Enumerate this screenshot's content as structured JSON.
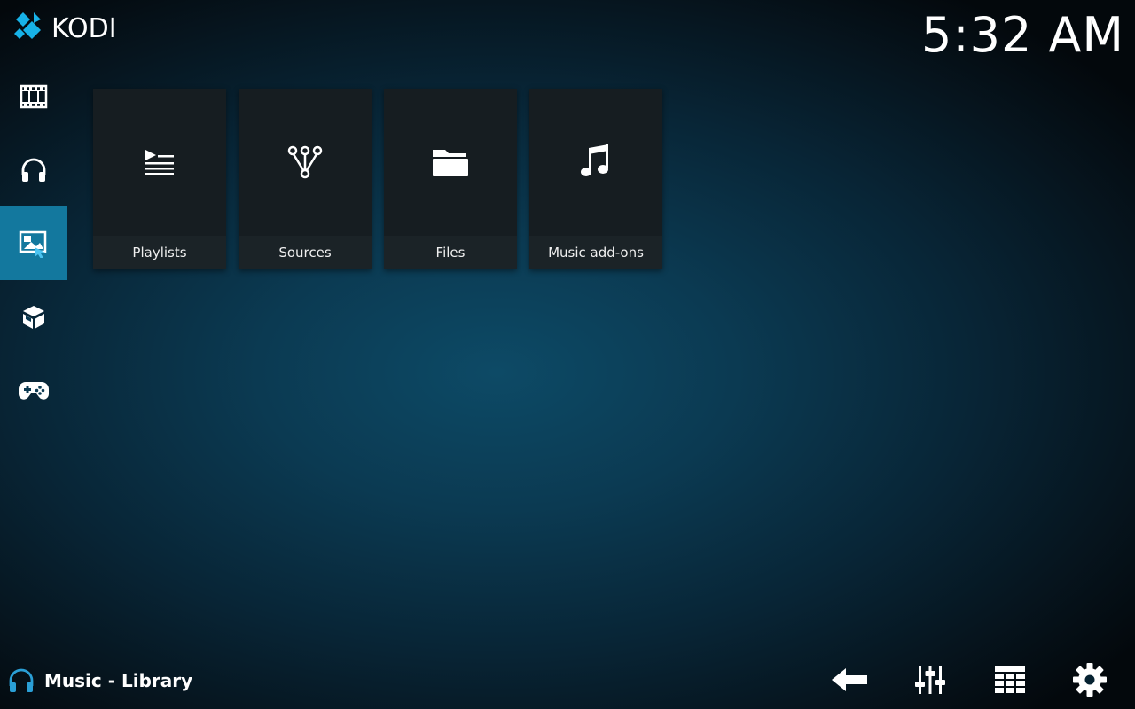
{
  "app": {
    "logo_text": "KODI"
  },
  "clock": {
    "time": "5:32 AM"
  },
  "sidebar": {
    "items": [
      {
        "icon": "movies-icon",
        "active": false
      },
      {
        "icon": "music-headphones-icon",
        "active": false
      },
      {
        "icon": "pictures-icon",
        "active": true
      },
      {
        "icon": "addons-box-icon",
        "active": false
      },
      {
        "icon": "games-controller-icon",
        "active": false
      }
    ]
  },
  "tiles": [
    {
      "label": "Playlists",
      "icon": "playlist-icon"
    },
    {
      "label": "Sources",
      "icon": "sources-icon"
    },
    {
      "label": "Files",
      "icon": "folder-icon"
    },
    {
      "label": "Music add-ons",
      "icon": "music-note-icon"
    }
  ],
  "footer": {
    "section_icon": "headphones-icon",
    "section_title": "Music - Library",
    "actions": [
      "back-arrow-icon",
      "equalizer-icon",
      "grid-icon",
      "settings-gear-icon"
    ]
  },
  "colors": {
    "accent": "#13789e",
    "tile_bg": "#161d21",
    "section_icon": "#2a9fd6"
  }
}
